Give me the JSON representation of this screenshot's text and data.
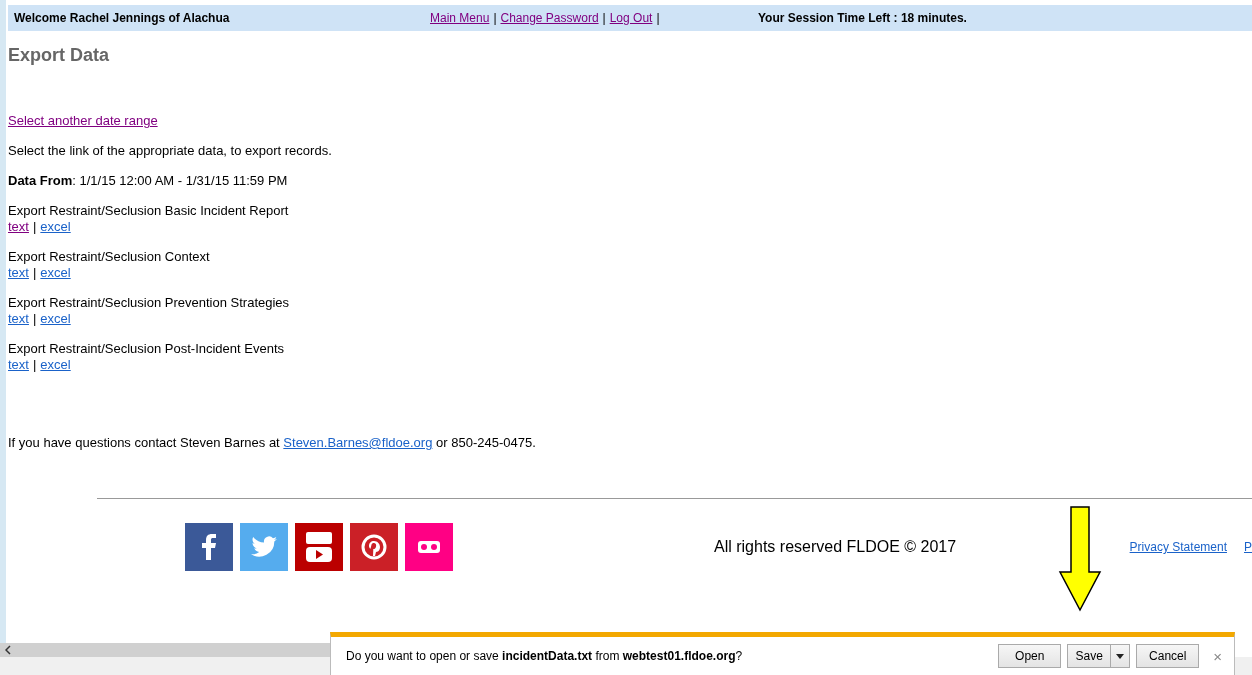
{
  "header": {
    "welcome": "Welcome Rachel Jennings of Alachua",
    "separator": "|",
    "links": [
      {
        "label": "Main Menu",
        "visited": true
      },
      {
        "label": "Change Password",
        "visited": true
      },
      {
        "label": "Log Out",
        "visited": true
      }
    ],
    "session": "Your Session Time Left : 18 minutes."
  },
  "title": "Export Data",
  "back_link": {
    "label": "Select another date range",
    "visited": true
  },
  "instruction": "Select the link of the appropriate data, to export records.",
  "data_from": "**Data From**: 1/1/15 12:00 AM - 1/31/15 11:59 PM",
  "exports": [
    {
      "title": "Export Restraint/Seclusion Basic Incident Report",
      "separator": "|",
      "links": [
        {
          "label": "text",
          "visited": true
        },
        {
          "label": "excel",
          "visited": false
        }
      ]
    },
    {
      "title": "Export Restraint/Seclusion Context",
      "separator": "|",
      "links": [
        {
          "label": "text",
          "visited": false
        },
        {
          "label": "excel",
          "visited": false
        }
      ]
    },
    {
      "title": "Export Restraint/Seclusion Prevention Strategies",
      "separator": "|",
      "links": [
        {
          "label": "text",
          "visited": false
        },
        {
          "label": "excel",
          "visited": false
        }
      ]
    },
    {
      "title": "Export Restraint/Seclusion Post-Incident Events",
      "separator": "|",
      "links": [
        {
          "label": "text",
          "visited": false
        },
        {
          "label": "excel",
          "visited": false
        }
      ]
    }
  ],
  "contact": {
    "before": "If you have questions contact Steven Barnes at ",
    "email": "Steven.Barnes@fldoe.org",
    "after": " or 850-245-0475."
  },
  "footer": {
    "social": [
      {
        "kind": "facebook",
        "color": "#3b5998"
      },
      {
        "kind": "twitter",
        "color": "#55acee"
      },
      {
        "kind": "youtube",
        "color": "#bb0000"
      },
      {
        "kind": "pinterest",
        "color": "#cb2027"
      },
      {
        "kind": "flickr",
        "color": "#ff0084"
      }
    ],
    "copyright": "All rights reserved FLDOE © 2017",
    "links": [
      "Privacy Statement",
      "P"
    ]
  },
  "download_bar": {
    "prompt": "Do you want to open or save **incidentData.txt** from **webtest01.fldoe.org**?",
    "buttons": [
      {
        "label": "Open",
        "kind": "plain"
      },
      {
        "label": "Save",
        "kind": "split"
      },
      {
        "label": "Cancel",
        "kind": "plain"
      }
    ],
    "close": "×"
  }
}
